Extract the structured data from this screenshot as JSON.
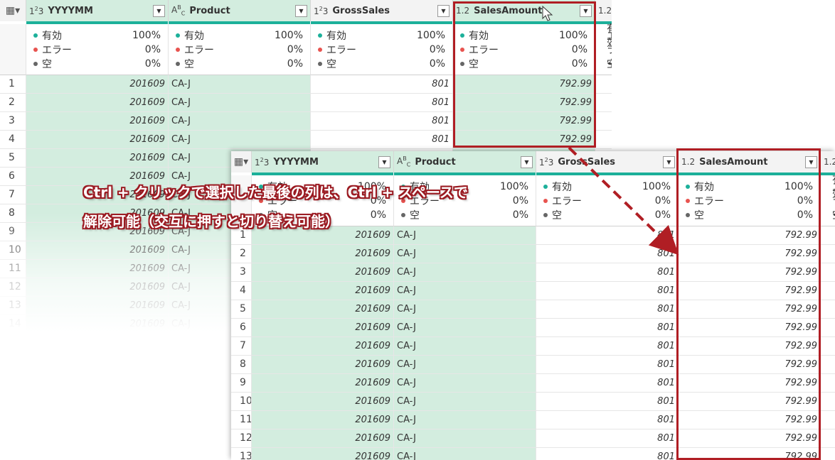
{
  "back": {
    "columns": [
      {
        "type_icon": "1²3",
        "name": "YYYYMM"
      },
      {
        "type_icon": "A^B_C",
        "name": "Product"
      },
      {
        "type_icon": "1²3",
        "name": "GrossSales"
      },
      {
        "type_icon": "1.2",
        "name": "SalesAmount"
      },
      {
        "type_icon": "1.2",
        "name": ""
      }
    ],
    "stats": [
      {
        "label": "有効",
        "pct": "100%"
      },
      {
        "label": "エラー",
        "pct": "0%"
      },
      {
        "label": "空",
        "pct": "0%"
      }
    ],
    "rows": [
      {
        "n": "1",
        "yyyymm": "201609",
        "product": "CA-J",
        "gross": "801",
        "sales": "792.99"
      },
      {
        "n": "2",
        "yyyymm": "201609",
        "product": "CA-J",
        "gross": "801",
        "sales": "792.99"
      },
      {
        "n": "3",
        "yyyymm": "201609",
        "product": "CA-J",
        "gross": "801",
        "sales": "792.99"
      },
      {
        "n": "4",
        "yyyymm": "201609",
        "product": "CA-J",
        "gross": "801",
        "sales": "792.99"
      },
      {
        "n": "5",
        "yyyymm": "201609",
        "product": "CA-J",
        "gross": "",
        "sales": ""
      },
      {
        "n": "6",
        "yyyymm": "201609",
        "product": "CA-J",
        "gross": "",
        "sales": ""
      },
      {
        "n": "7",
        "yyyymm": "201609",
        "product": "CA-J",
        "gross": "",
        "sales": ""
      },
      {
        "n": "8",
        "yyyymm": "201609",
        "product": "CA-J",
        "gross": "",
        "sales": ""
      },
      {
        "n": "9",
        "yyyymm": "201609",
        "product": "CA-J",
        "gross": "",
        "sales": ""
      },
      {
        "n": "10",
        "yyyymm": "201609",
        "product": "CA-J",
        "gross": "",
        "sales": ""
      },
      {
        "n": "11",
        "yyyymm": "201609",
        "product": "CA-J",
        "gross": "",
        "sales": ""
      },
      {
        "n": "12",
        "yyyymm": "201609",
        "product": "CA-J",
        "gross": "",
        "sales": ""
      },
      {
        "n": "13",
        "yyyymm": "201609",
        "product": "CA-J",
        "gross": "",
        "sales": ""
      },
      {
        "n": "14",
        "yyyymm": "201609",
        "product": "CA-J",
        "gross": "",
        "sales": ""
      }
    ]
  },
  "front": {
    "columns": [
      {
        "type_icon": "1²3",
        "name": "YYYYMM"
      },
      {
        "type_icon": "A^B_C",
        "name": "Product"
      },
      {
        "type_icon": "1²3",
        "name": "GrossSales"
      },
      {
        "type_icon": "1.2",
        "name": "SalesAmount"
      },
      {
        "type_icon": "1.2",
        "name": ""
      }
    ],
    "stats": [
      {
        "label": "有効",
        "pct": "100%"
      },
      {
        "label": "エラー",
        "pct": "0%"
      },
      {
        "label": "空",
        "pct": "0%"
      }
    ],
    "rows": [
      {
        "n": "1",
        "yyyymm": "201609",
        "product": "CA-J",
        "gross": "801",
        "sales": "792.99"
      },
      {
        "n": "2",
        "yyyymm": "201609",
        "product": "CA-J",
        "gross": "801",
        "sales": "792.99"
      },
      {
        "n": "3",
        "yyyymm": "201609",
        "product": "CA-J",
        "gross": "801",
        "sales": "792.99"
      },
      {
        "n": "4",
        "yyyymm": "201609",
        "product": "CA-J",
        "gross": "801",
        "sales": "792.99"
      },
      {
        "n": "5",
        "yyyymm": "201609",
        "product": "CA-J",
        "gross": "801",
        "sales": "792.99"
      },
      {
        "n": "6",
        "yyyymm": "201609",
        "product": "CA-J",
        "gross": "801",
        "sales": "792.99"
      },
      {
        "n": "7",
        "yyyymm": "201609",
        "product": "CA-J",
        "gross": "801",
        "sales": "792.99"
      },
      {
        "n": "8",
        "yyyymm": "201609",
        "product": "CA-J",
        "gross": "801",
        "sales": "792.99"
      },
      {
        "n": "9",
        "yyyymm": "201609",
        "product": "CA-J",
        "gross": "801",
        "sales": "792.99"
      },
      {
        "n": "10",
        "yyyymm": "201609",
        "product": "CA-J",
        "gross": "801",
        "sales": "792.99"
      },
      {
        "n": "11",
        "yyyymm": "201609",
        "product": "CA-J",
        "gross": "801",
        "sales": "792.99"
      },
      {
        "n": "12",
        "yyyymm": "201609",
        "product": "CA-J",
        "gross": "801",
        "sales": "792.99"
      },
      {
        "n": "13",
        "yyyymm": "201609",
        "product": "CA-J",
        "gross": "801",
        "sales": "792.99"
      }
    ]
  },
  "callout": {
    "line1": "Ctrl + クリックで選択した最後の列は、Ctrl + スペースで",
    "line2": "解除可能（交互に押すと切り替え可能）"
  },
  "colors": {
    "selected_column": "#d3eddf",
    "quality_bar": "#1cb09a",
    "valid_dot": "#1cb09a",
    "error_dot": "#e8534f",
    "empty_dot": "#666666",
    "highlight": "#b01e24"
  },
  "icons": {
    "corner": "table-menu-icon",
    "dropdown": "chevron-down-icon",
    "cursor": "mouse-pointer-icon"
  }
}
